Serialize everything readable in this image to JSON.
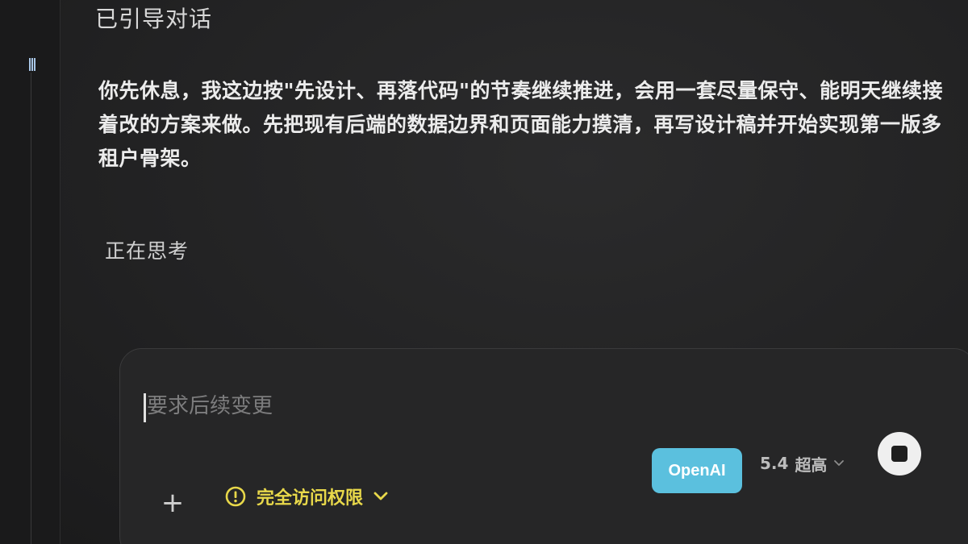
{
  "conversation": {
    "status_title": "已引导对话",
    "message": "你先休息，我这边按\"先设计、再落代码\"的节奏继续推进，会用一套尽量保守、能明天继续接着改的方案来做。先把现有后端的数据边界和页面能力摸清，再写设计稿并开始实现第一版多租户骨架。",
    "thinking_label": "正在思考"
  },
  "composer": {
    "placeholder": "要求后续变更",
    "value": "",
    "add_label": "+",
    "access_label": "完全访问权限",
    "provider_badge": "OpenAI",
    "model_version": "5.4",
    "model_tier": "超高"
  },
  "icons": {
    "add": "plus-icon",
    "access_warning": "warning-circle-icon",
    "access_chevron": "chevron-down-icon",
    "model_chevron": "chevron-down-icon",
    "stop": "stop-icon"
  },
  "colors": {
    "background": "#1e1e1f",
    "access_accent": "#e8d84a",
    "provider_badge": "#5bc0de",
    "stop_button": "#efefef"
  }
}
